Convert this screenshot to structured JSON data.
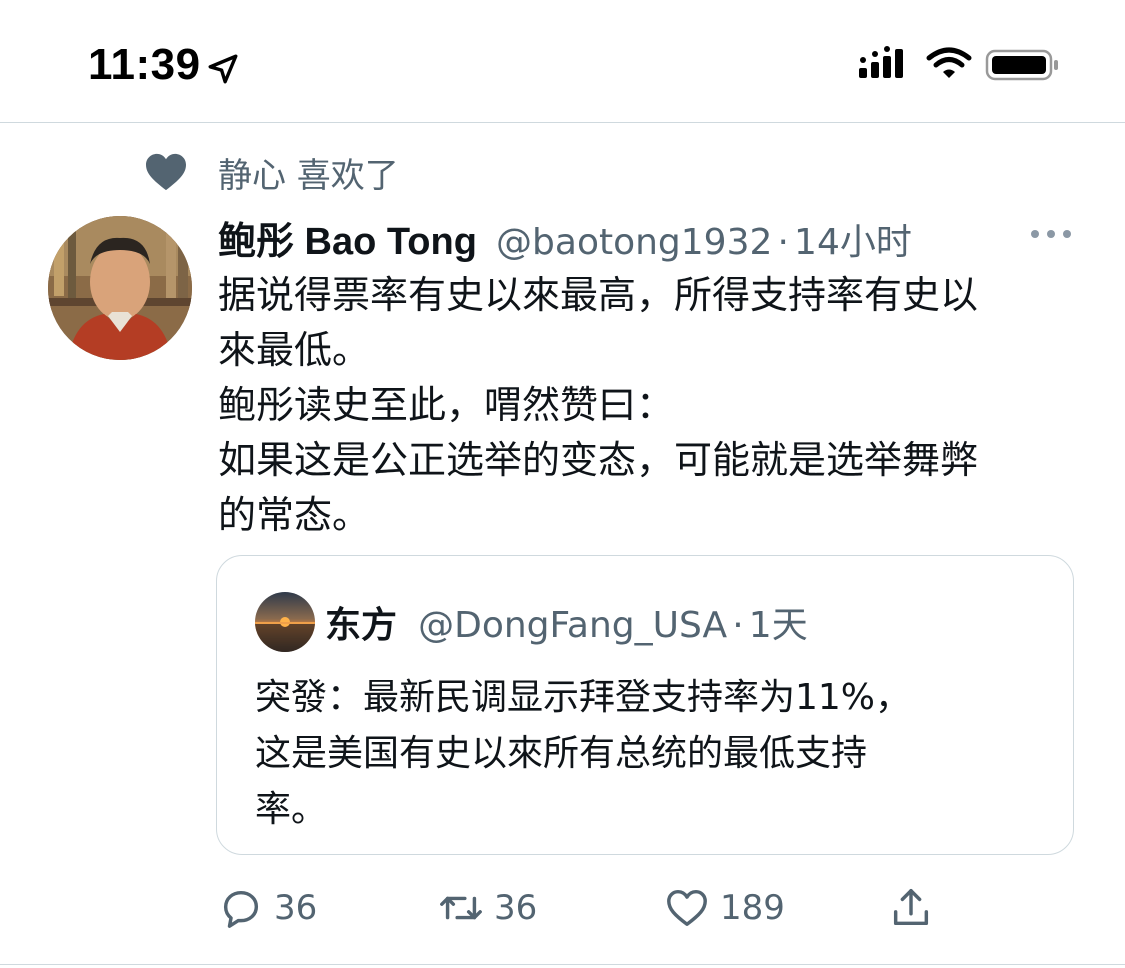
{
  "status_bar": {
    "time": "11:39",
    "icons": [
      "location-arrow-icon",
      "cellular-signal-icon",
      "wifi-icon",
      "battery-icon"
    ]
  },
  "social_context": {
    "text": "静心 喜欢了",
    "icon": "heart-filled-icon"
  },
  "tweet": {
    "author_name": "鲍彤 Bao Tong",
    "author_handle": "@baotong1932",
    "separator": "·",
    "time": "14小时",
    "more_icon": "more-horizontal-icon",
    "body_lines": [
      "据说得票率有史以來最高，所得支持率有史以",
      "來最低。",
      "鲍彤读史至此，喟然赞曰：",
      "如果这是公正选举的变态，可能就是选举舞弊",
      "的常态。"
    ]
  },
  "quoted_tweet": {
    "author_name": "东方",
    "author_handle": "@DongFang_USA",
    "separator": "·",
    "time": "1天",
    "body_lines": [
      "突發：最新民调显示拜登支持率为11%，",
      "这是美国有史以來所有总统的最低支持",
      "率。"
    ]
  },
  "actions": {
    "reply_count": "36",
    "retweet_count": "36",
    "like_count": "189",
    "icons": [
      "reply-icon",
      "retweet-icon",
      "like-icon",
      "share-icon"
    ]
  },
  "colors": {
    "text_primary": "#0f1419",
    "text_secondary": "#536471",
    "border": "#cfd9de"
  }
}
